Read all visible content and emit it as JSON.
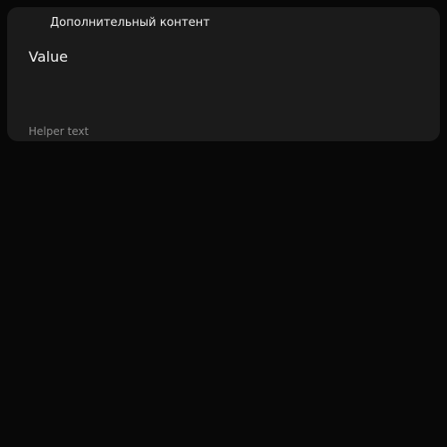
{
  "header": {
    "icon": "eye-icon",
    "label": "Дополнительный контент"
  },
  "field": {
    "value": "Value",
    "helper_text": "Helper text"
  },
  "colors": {
    "background": "#080808",
    "surface": "#1b1b1b",
    "text_primary": "#f2f2f2",
    "text_secondary": "#8a8a8a"
  }
}
